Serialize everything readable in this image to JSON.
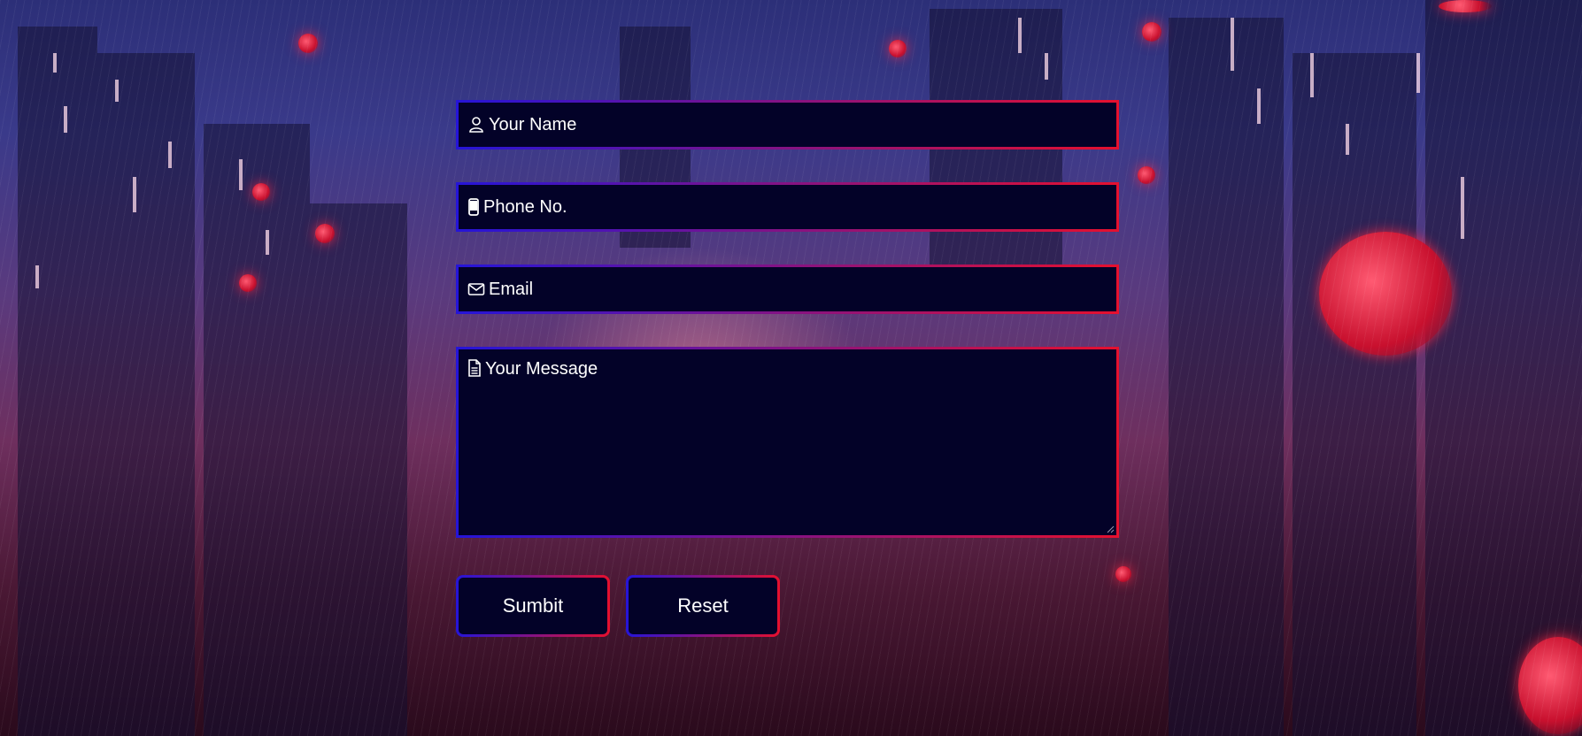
{
  "form": {
    "name_placeholder": "Your Name",
    "phone_placeholder": "Phone No.",
    "email_placeholder": "Email",
    "message_placeholder": "Your Message"
  },
  "buttons": {
    "submit_label": "Sumbit",
    "reset_label": "Reset"
  },
  "icons": {
    "name": "user-icon",
    "phone": "mobile-phone-icon",
    "email": "envelope-icon",
    "message": "document-icon"
  },
  "colors": {
    "field_background": "#030228",
    "border_gradient_start": "#2514d8",
    "border_gradient_end": "#e5102e",
    "text": "#ffffff"
  }
}
